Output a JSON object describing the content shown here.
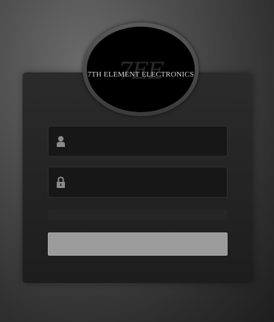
{
  "brand": {
    "name": "7TH ELEMENT ELECTRONICS",
    "monogram": "7EE"
  },
  "login": {
    "username_icon": "user-icon",
    "username_placeholder": "",
    "username_value": "",
    "password_icon": "lock-icon",
    "password_placeholder": "",
    "password_value": "",
    "submit_label": ""
  },
  "colors": {
    "field_bg": "#171717",
    "button_bg": "#9b9b9b",
    "panel_bg": "#232323",
    "logo_bg": "#000000",
    "icon": "#8a8a8a"
  }
}
